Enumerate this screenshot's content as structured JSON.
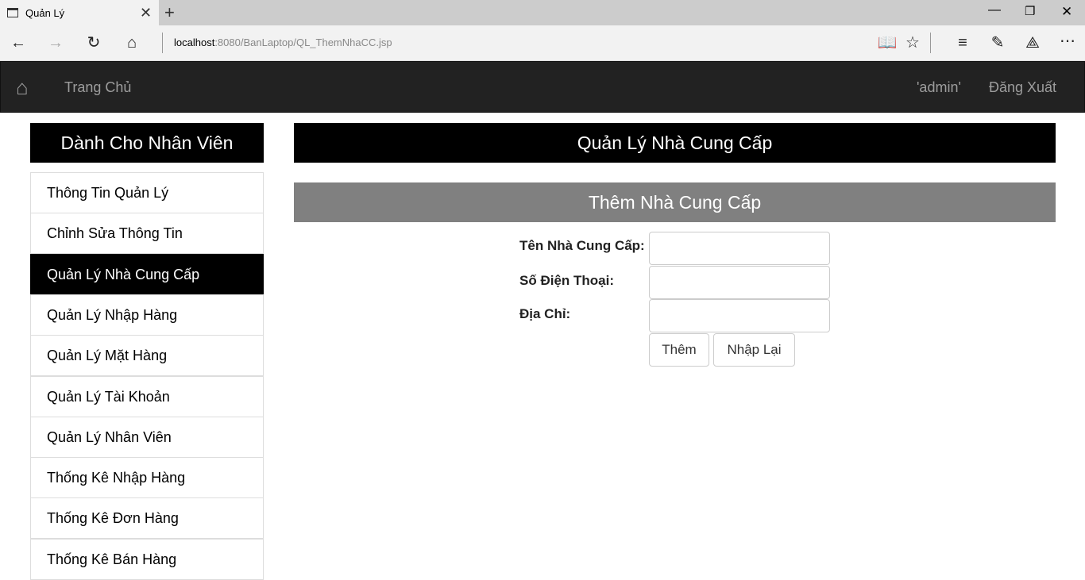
{
  "browser": {
    "tab_title": "Quản Lý",
    "url_host": "localhost",
    "url_path": ":8080/BanLaptop/QL_ThemNhaCC.jsp"
  },
  "navbar": {
    "home": "Trang Chủ",
    "user": "'admin'",
    "logout": "Đăng Xuất"
  },
  "sidebar": {
    "title": "Dành Cho Nhân Viên",
    "items": [
      {
        "label": "Thông Tin Quản Lý"
      },
      {
        "label": "Chỉnh Sửa Thông Tin"
      },
      {
        "label": "Quản Lý Nhà Cung Cấp"
      },
      {
        "label": "Quản Lý Nhập Hàng"
      },
      {
        "label": "Quản Lý Mặt Hàng"
      },
      {
        "label": "Quản Lý Tài Khoản"
      },
      {
        "label": "Quản Lý Nhân Viên"
      },
      {
        "label": "Thống Kê Nhập Hàng"
      },
      {
        "label": "Thống Kê Đơn Hàng"
      },
      {
        "label": "Thống Kê Bán Hàng"
      }
    ],
    "active_index": 2
  },
  "main": {
    "title": "Quản Lý Nhà Cung Cấp",
    "subtitle": "Thêm Nhà Cung Cấp",
    "form": {
      "name_label": "Tên Nhà Cung Cấp:",
      "phone_label": "Số Điện Thoại:",
      "address_label": "Địa Chỉ:",
      "name_value": "",
      "phone_value": "",
      "address_value": "",
      "submit": "Thêm",
      "reset": "Nhập Lại"
    }
  }
}
